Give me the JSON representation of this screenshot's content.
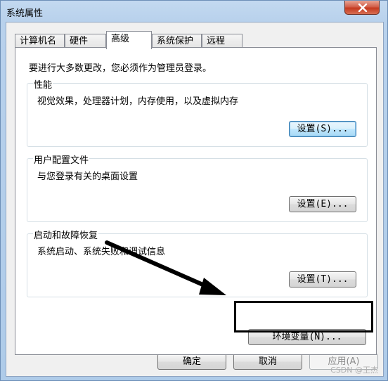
{
  "window": {
    "title": "系统属性"
  },
  "tabs": [
    {
      "label": "计算机名"
    },
    {
      "label": "硬件"
    },
    {
      "label": "高级"
    },
    {
      "label": "系统保护"
    },
    {
      "label": "远程"
    }
  ],
  "panel": {
    "intro": "要进行大多数更改，您必须作为管理员登录。",
    "performance": {
      "title": "性能",
      "desc": "视觉效果，处理器计划，内存使用，以及虚拟内存",
      "button": "设置(S)..."
    },
    "profiles": {
      "title": "用户配置文件",
      "desc": "与您登录有关的桌面设置",
      "button": "设置(E)..."
    },
    "startup": {
      "title": "启动和故障恢复",
      "desc": "系统启动、系统失败和调试信息",
      "button": "设置(T)..."
    },
    "env_button": "环境变量(N)..."
  },
  "footer": {
    "ok": "确定",
    "cancel": "取消",
    "apply": "应用(A)"
  },
  "watermark": "CSDN @王杰",
  "icons": {
    "close": "close-icon",
    "annotation": "annotation-arrow-icon"
  }
}
